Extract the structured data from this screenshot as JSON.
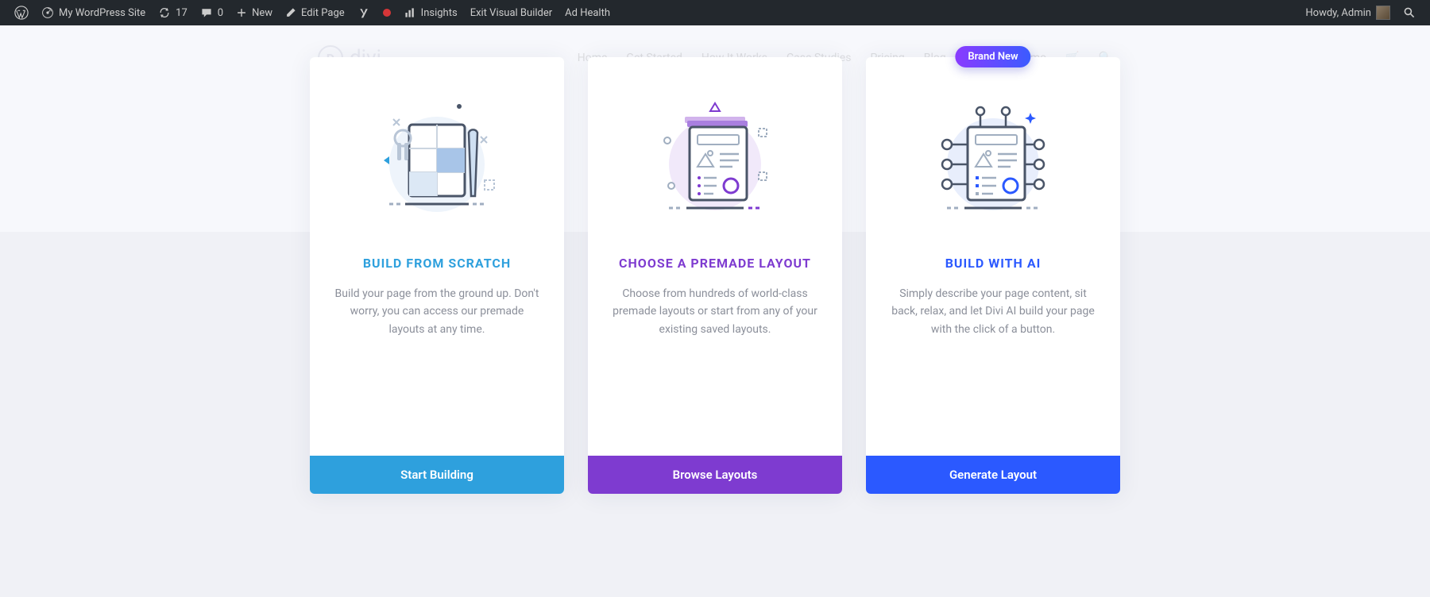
{
  "adminbar": {
    "site_name": "My WordPress Site",
    "updates_count": "17",
    "comments_count": "0",
    "new_label": "New",
    "edit_page_label": "Edit Page",
    "insights_label": "Insights",
    "exit_builder_label": "Exit Visual Builder",
    "ad_health_label": "Ad Health",
    "howdy_label": "Howdy, Admin"
  },
  "faint_nav": {
    "logo_text": "divi",
    "links": [
      "Home",
      "Get Started",
      "How It Works",
      "Case Studies",
      "Pricing",
      "Blog",
      "Request a Demo"
    ]
  },
  "cards": [
    {
      "title": "BUILD FROM SCRATCH",
      "desc": "Build your page from the ground up. Don't worry, you can access our premade layouts at any time.",
      "button": "Start Building"
    },
    {
      "title": "CHOOSE A PREMADE LAYOUT",
      "desc": "Choose from hundreds of world-class premade layouts or start from any of your existing saved layouts.",
      "button": "Browse Layouts"
    },
    {
      "title": "BUILD WITH AI",
      "desc": "Simply describe your page content, sit back, relax, and let Divi AI build your page with the click of a button.",
      "button": "Generate Layout",
      "badge": "Brand New"
    }
  ]
}
